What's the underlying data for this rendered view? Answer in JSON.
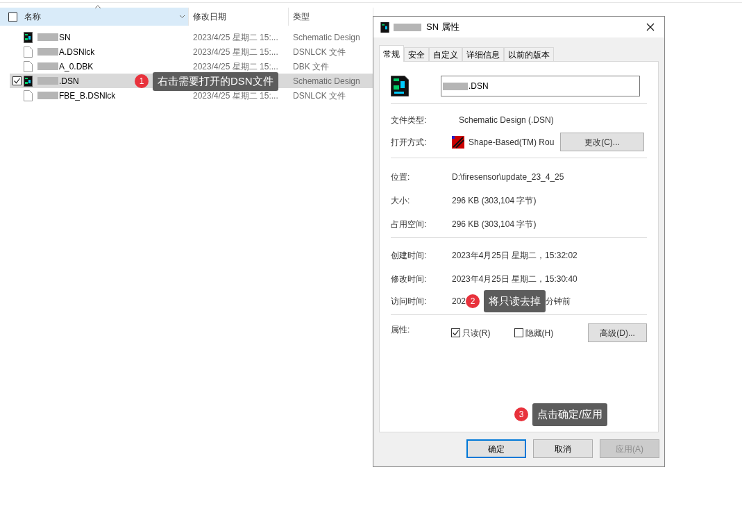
{
  "explorer": {
    "columns": [
      {
        "label": "名称",
        "sorted": true
      },
      {
        "label": "修改日期",
        "sorted": false
      },
      {
        "label": "类型",
        "sorted": false
      }
    ],
    "rows": [
      {
        "name": "SN",
        "date": "2023/4/25 星期二 15:...",
        "type": "Schematic Design",
        "kind": "schematic",
        "selected": false,
        "checked": false
      },
      {
        "name": "A.DSNlck",
        "date": "2023/4/25 星期二 15:...",
        "type": "DSNLCK 文件",
        "kind": "file",
        "selected": false,
        "checked": false
      },
      {
        "name": "A_0.DBK",
        "date": "2023/4/25 星期二 15:...",
        "type": "DBK 文件",
        "kind": "file",
        "selected": false,
        "checked": false
      },
      {
        "name": ".DSN",
        "type": "Schematic Design",
        "kind": "schematic",
        "selected": true,
        "checked": true
      },
      {
        "name": "FBE_B.DSNlck",
        "date": "2023/4/25 星期二 15:...",
        "type": "DSNLCK 文件",
        "kind": "file",
        "selected": false,
        "checked": false
      }
    ]
  },
  "dialog": {
    "title": "SN 属性",
    "tabs": [
      {
        "label": "常规",
        "selected": true
      },
      {
        "label": "安全",
        "selected": false
      },
      {
        "label": "自定义",
        "selected": false
      },
      {
        "label": "详细信息",
        "selected": false
      },
      {
        "label": "以前的版本",
        "selected": false
      }
    ],
    "file_name": ".DSN",
    "file_type": {
      "label": "文件类型:",
      "value": "Schematic Design (.DSN)"
    },
    "open_with": {
      "label": "打开方式:",
      "value": "Shape-Based(TM) Rou",
      "button": "更改(C)..."
    },
    "location": {
      "label": "位置:",
      "value": "D:\\firesensor\\update_23_4_25"
    },
    "size": {
      "label": "大小:",
      "value": "296 KB (303,104 字节)"
    },
    "disk_size": {
      "label": "占用空间:",
      "value": "296 KB (303,104 字节)"
    },
    "created": {
      "label": "创建时间:",
      "value": "2023年4月25日 星期二，15:32:02"
    },
    "modified": {
      "label": "修改时间:",
      "value": "2023年4月25日 星期二，15:30:40"
    },
    "accessed": {
      "label": "访问时间:",
      "value_start": "202",
      "value_end": "分钟前"
    },
    "attributes": {
      "label": "属性:",
      "readonly": {
        "label": "只读(R)",
        "checked": true
      },
      "hidden": {
        "label": "隐藏(H)",
        "checked": false
      },
      "advanced": "高级(D)..."
    },
    "buttons": [
      {
        "label": "确定",
        "kind": "default",
        "disabled": false
      },
      {
        "label": "取消",
        "kind": "normal",
        "disabled": false
      },
      {
        "label": "应用(A)",
        "kind": "normal",
        "disabled": true
      }
    ]
  },
  "callouts": [
    {
      "number": "1",
      "text": "右击需要打开的DSN文件"
    },
    {
      "number": "2",
      "text": "将只读去掉"
    },
    {
      "number": "3",
      "text": "点击确定/应用"
    }
  ]
}
